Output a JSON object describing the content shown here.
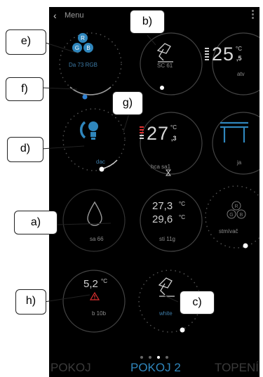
{
  "header": {
    "back_glyph": "‹",
    "menu_label": "Menu"
  },
  "tiles": {
    "rgb_light": {
      "label": "Da 73 RGB",
      "letters": [
        "R",
        "G",
        "B"
      ]
    },
    "desk_lamp": {
      "label": "SC 61"
    },
    "temp1": {
      "temp": "25",
      "unit": "°C",
      "decimal": ",5",
      "label": "atv"
    },
    "bulb": {
      "label": "dac"
    },
    "temp2": {
      "temp": "27",
      "unit": "°C",
      "decimal": ",3",
      "label": "hca sa1"
    },
    "table": {
      "label": "ja"
    },
    "drop": {
      "label": "sa 66"
    },
    "double_temp": {
      "t1": "27,3",
      "t2": "29,6",
      "unit": "°C",
      "label": "sti 11g"
    },
    "rgb_off": {
      "label": "stmívač",
      "letters": [
        "R",
        "G",
        "B"
      ]
    },
    "alarm_temp": {
      "temp": "5,2",
      "unit": "°C",
      "label": "b 10b"
    },
    "white_lamp": {
      "label": "white"
    }
  },
  "pager": {
    "count": 4,
    "active": 3
  },
  "tabs": [
    {
      "label": "POKOJ"
    },
    {
      "label": "POKOJ 2"
    },
    {
      "label": "TOPENÍ"
    }
  ],
  "callouts": [
    "a)",
    "b)",
    "c)",
    "d)",
    "e)",
    "f)",
    "g)",
    "h)"
  ],
  "colors": {
    "accent": "#2f86bc",
    "alarm": "#e03030",
    "ring": "#3a3a3a"
  }
}
